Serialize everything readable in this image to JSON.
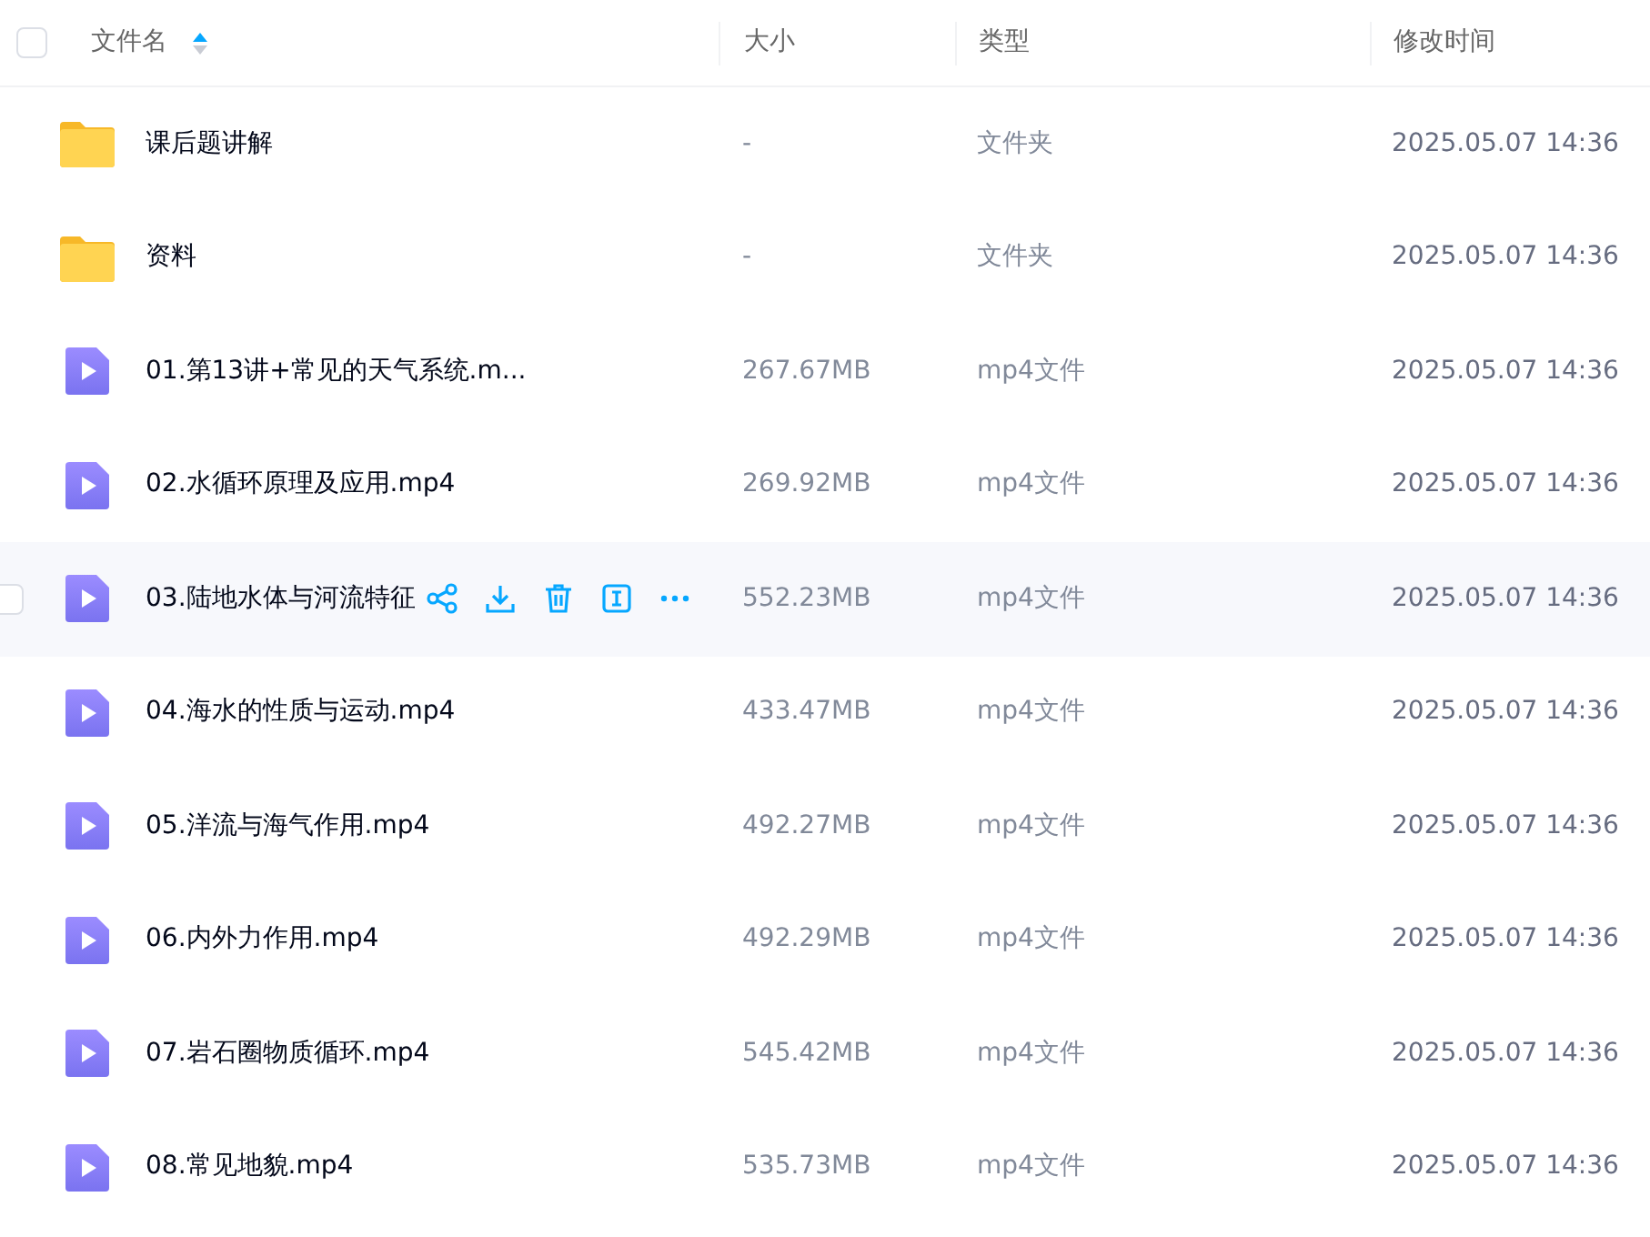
{
  "select_all": {
    "checked": false
  },
  "columns": [
    {
      "label": "文件名",
      "sorted": true
    },
    {
      "label": "大小"
    },
    {
      "label": "类型"
    },
    {
      "label": "修改时间"
    }
  ],
  "rows": [
    {
      "kind": "folder",
      "name": "课后题讲解",
      "size": "-",
      "type": "文件夹",
      "modified": "2025.05.07 14:36",
      "hovered": false
    },
    {
      "kind": "folder",
      "name": "资料",
      "size": "-",
      "type": "文件夹",
      "modified": "2025.05.07 14:36",
      "hovered": false
    },
    {
      "kind": "video",
      "name": "01.第13讲+常见的天气系统.m...",
      "size": "267.67MB",
      "type": "mp4文件",
      "modified": "2025.05.07 14:36",
      "hovered": false
    },
    {
      "kind": "video",
      "name": "02.水循环原理及应用.mp4",
      "size": "269.92MB",
      "type": "mp4文件",
      "modified": "2025.05.07 14:36",
      "hovered": false
    },
    {
      "kind": "video",
      "name": "03.陆地水体与河流特征",
      "size": "552.23MB",
      "type": "mp4文件",
      "modified": "2025.05.07 14:36",
      "hovered": true
    },
    {
      "kind": "video",
      "name": "04.海水的性质与运动.mp4",
      "size": "433.47MB",
      "type": "mp4文件",
      "modified": "2025.05.07 14:36",
      "hovered": false
    },
    {
      "kind": "video",
      "name": "05.洋流与海气作用.mp4",
      "size": "492.27MB",
      "type": "mp4文件",
      "modified": "2025.05.07 14:36",
      "hovered": false
    },
    {
      "kind": "video",
      "name": "06.内外力作用.mp4",
      "size": "492.29MB",
      "type": "mp4文件",
      "modified": "2025.05.07 14:36",
      "hovered": false
    },
    {
      "kind": "video",
      "name": "07.岩石圈物质循环.mp4",
      "size": "545.42MB",
      "type": "mp4文件",
      "modified": "2025.05.07 14:36",
      "hovered": false
    },
    {
      "kind": "video",
      "name": "08.常见地貌.mp4",
      "size": "535.73MB",
      "type": "mp4文件",
      "modified": "2025.05.07 14:36",
      "hovered": false
    }
  ]
}
